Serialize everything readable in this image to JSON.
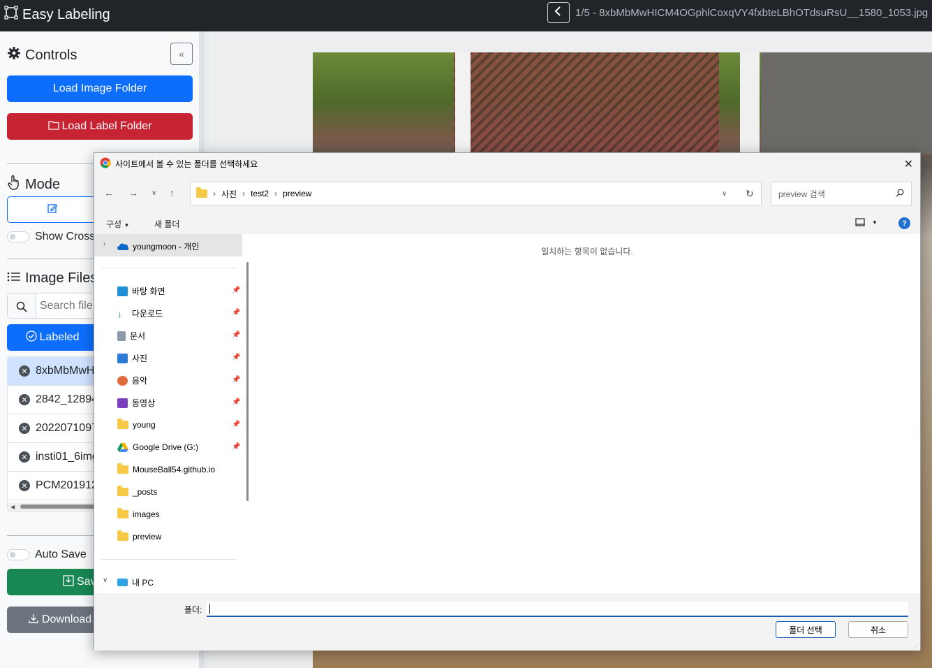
{
  "navbar": {
    "app_title": "Easy Labeling",
    "file_title": "1/5 - 8xbMbMwHICM4OGphlCoxqVY4fxbteLBhOTdsuRsU__1580_1053.jpg"
  },
  "sidebar": {
    "controls_title": "Controls",
    "load_image_folder": "Load Image Folder",
    "load_label_folder": "Load Label Folder",
    "mode_title": "Mode",
    "show_crosshair": "Show Crossl",
    "image_files_title": "Image Files",
    "search_placeholder": "Search file",
    "labeled_label": "Labeled",
    "files": [
      "8xbMbMwH",
      "2842_12894",
      "2022071097",
      "insti01_6img",
      "PCM201912"
    ],
    "auto_save": "Auto Save",
    "save_label": "Sav",
    "download_label": "Download"
  },
  "dialog": {
    "title": "사이트에서 볼 수 있는 폴더를 선택하세요",
    "breadcrumb": [
      "사진",
      "test2",
      "preview"
    ],
    "search_placeholder": "preview 검색",
    "organize": "구성",
    "new_folder": "새 폴더",
    "onedrive": "youngmoon - 개인",
    "quick_access": [
      "바탕 화면",
      "다운로드",
      "문서",
      "사진",
      "음악",
      "동영상",
      "young",
      "Google Drive (G:)",
      "MouseBall54.github.io",
      "_posts",
      "images",
      "preview"
    ],
    "this_pc": "내 PC",
    "empty_message": "일치하는 항목이 없습니다.",
    "folder_label": "폴더:",
    "folder_value": "",
    "select_button": "폴더 선택",
    "cancel_button": "취소"
  },
  "colors": {
    "primary": "#0d6efd",
    "danger": "#c82333",
    "success": "#198754",
    "secondary": "#6c757d",
    "navbar": "#212529"
  }
}
